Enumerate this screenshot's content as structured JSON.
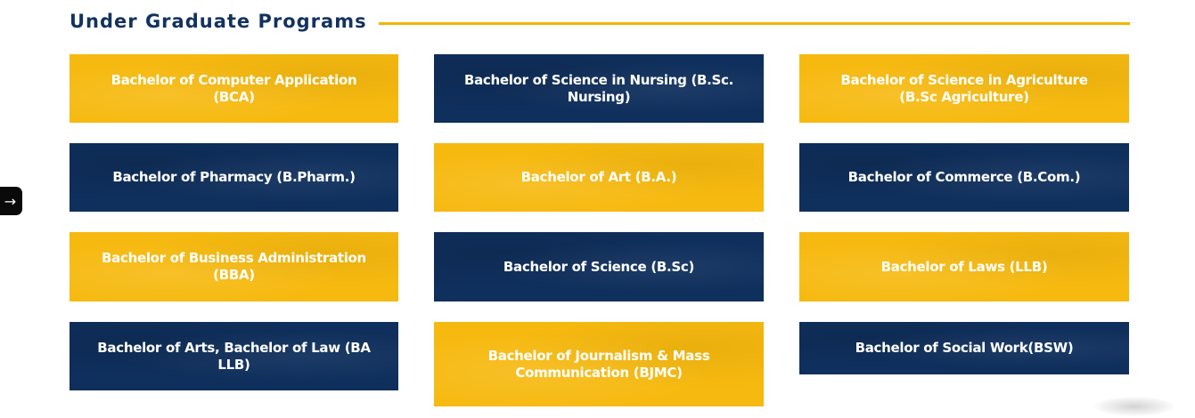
{
  "section": {
    "title": "Under Graduate Programs"
  },
  "programs": [
    {
      "label": "Bachelor of Computer Application (BCA)",
      "color": "#f6b90f"
    },
    {
      "label": "Bachelor of Science in Nursing (B.Sc. Nursing)",
      "color": "#0f2f5c"
    },
    {
      "label": "Bachelor of Science in Agriculture (B.Sc Agriculture)",
      "color": "#f6b90f"
    },
    {
      "label": "Bachelor of Pharmacy (B.Pharm.)",
      "color": "#0f2f5c"
    },
    {
      "label": "Bachelor of Art (B.A.)",
      "color": "#f6b90f"
    },
    {
      "label": "Bachelor of Commerce (B.Com.)",
      "color": "#0f2f5c"
    },
    {
      "label": "Bachelor of Business Administration (BBA)",
      "color": "#f6b90f"
    },
    {
      "label": "Bachelor of Science (B.Sc)",
      "color": "#0f2f5c"
    },
    {
      "label": "Bachelor of Laws (LLB)",
      "color": "#f6b90f"
    },
    {
      "label": "Bachelor of Arts, Bachelor of Law (BA LLB)",
      "color": "#0f2f5c"
    },
    {
      "label": "Bachelor of Journalism & Mass Communication (BJMC)",
      "color": "#f6b90f"
    },
    {
      "label": "Bachelor of Social Work(BSW)",
      "color": "#0f2f5c"
    }
  ],
  "side_tab": {
    "icon": "arrow-right-icon",
    "glyph": "→"
  },
  "theme": {
    "accent": "#f4b400",
    "navy": "#13325f"
  }
}
